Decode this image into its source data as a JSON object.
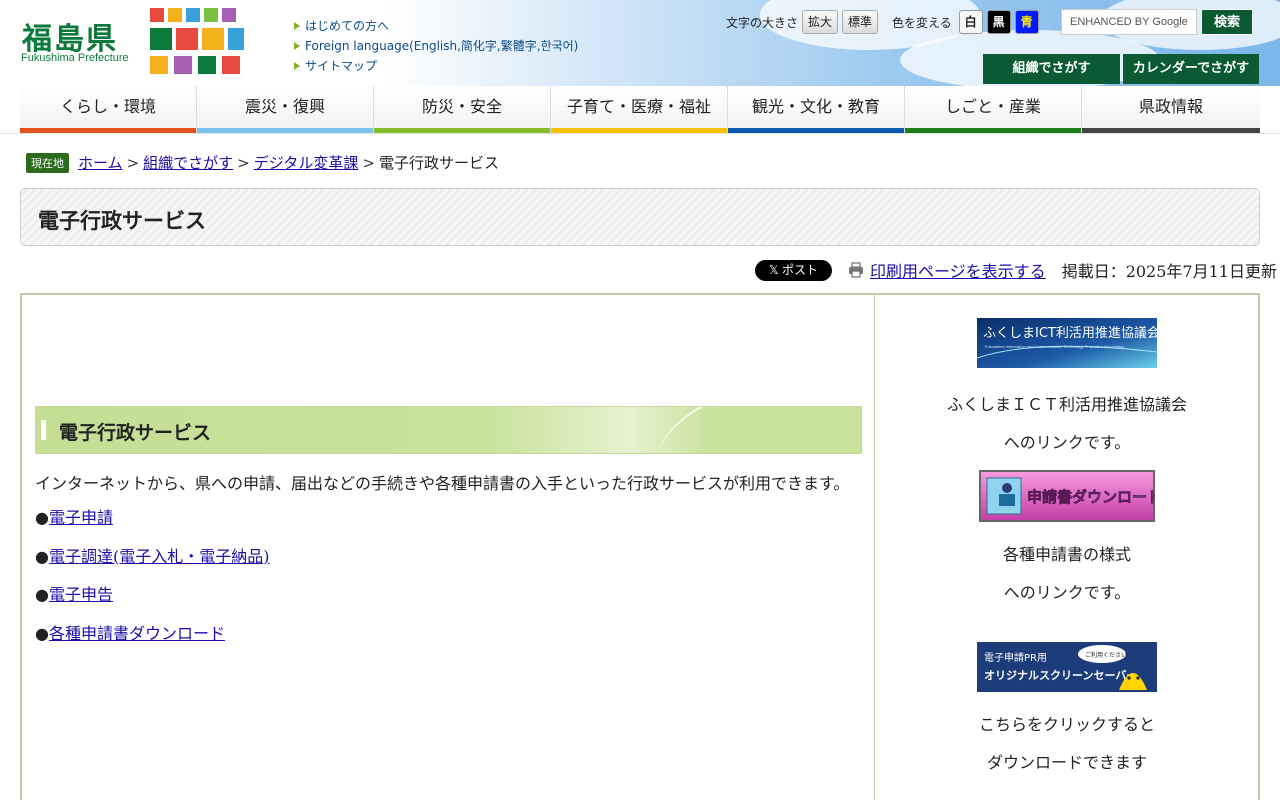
{
  "header": {
    "logo_kanji": "福島県",
    "logo_en": "Fukushima Prefecture",
    "top_links": [
      "はじめての方へ",
      "Foreign language(English,简化字,繁體字,한국어)",
      "サイトマップ"
    ],
    "font_size_label": "文字の大きさ",
    "font_size_options": [
      "拡大",
      "標準"
    ],
    "color_label": "色を変える",
    "color_options": [
      "白",
      "黒",
      "青"
    ],
    "search_placeholder": "ENHANCED BY Google",
    "search_button": "検索",
    "org_button": "組織でさがす",
    "calendar_button": "カレンダーでさがす"
  },
  "nav": {
    "items": [
      "くらし・環境",
      "震災・復興",
      "防災・安全",
      "子育て・医療・福祉",
      "観光・文化・教育",
      "しごと・産業",
      "県政情報"
    ],
    "colors": [
      "#e2541b",
      "#79c3ea",
      "#84bc2a",
      "#f5c000",
      "#0a5cb0",
      "#1a7f1a",
      "#444444"
    ]
  },
  "breadcrumb": {
    "here_label": "現在地",
    "items": [
      "ホーム",
      "組織でさがす",
      "デジタル変革課"
    ],
    "current": "電子行政サービス"
  },
  "page": {
    "title": "電子行政サービス",
    "xpost": "𝕏 ポスト",
    "print_link": "印刷用ページを表示する",
    "updated": "掲載日：2025年7月11日更新"
  },
  "main": {
    "section_title": "電子行政サービス",
    "intro": "インターネットから、県への申請、届出などの手続きや各種申請書の入手といった行政サービスが利用できます。",
    "bullet": "●",
    "links": [
      "電子申請",
      "電子調達(電子入札・電子納品)",
      "電子申告",
      "各種申請書ダウンロード"
    ]
  },
  "side": {
    "banner1_text": "ふくしまICT利活用推進協議会",
    "banner1_sub": "Fukushima Information and Communication Technology Promotion Association",
    "banner1_desc": [
      "ふくしまＩＣＴ利活用推進協議会",
      "へのリンクです。"
    ],
    "banner2_text": "申請書ダウンロード",
    "banner2_desc": [
      "各種申請書の様式",
      "へのリンクです。"
    ],
    "banner3_line1": "電子申請PR用",
    "banner3_line2": "オリジナルスクリーンセーバー",
    "banner3_bubble": "ご利用ください",
    "banner3_desc": [
      "こちらをクリックすると",
      "ダウンロードできます"
    ]
  }
}
